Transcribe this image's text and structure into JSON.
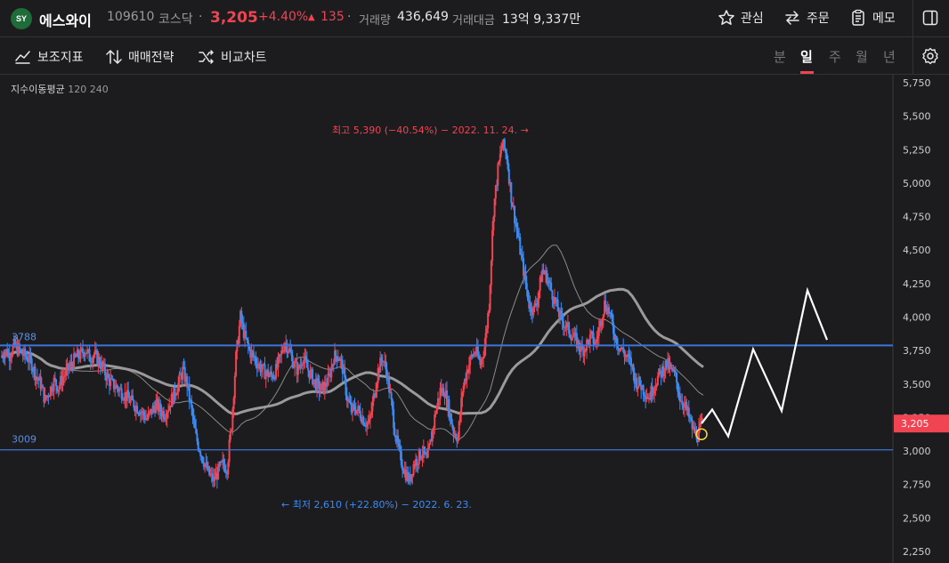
{
  "header": {
    "logo_text": "SY",
    "name": "에스와이",
    "code": "109610",
    "market": "코스닥",
    "dot": "·",
    "price": "3,205",
    "change_pct": "+4.40%",
    "change_arrow": "▲",
    "change_abs": "135",
    "volume_label": "거래량",
    "volume_value": "436,649",
    "amount_label": "거래대금",
    "amount_value": "13억 9,337만",
    "buttons": {
      "watch": "관심",
      "order": "주문",
      "memo": "메모"
    }
  },
  "toolbar": {
    "indicator": "보조지표",
    "strategy": "매매전략",
    "compare": "비교차트",
    "periods": [
      "분",
      "일",
      "주",
      "월",
      "년"
    ],
    "active_period": "일"
  },
  "legend": {
    "label": "지수이동평균",
    "p1": "120",
    "p2": "240"
  },
  "colors": {
    "up": "#f04452",
    "down": "#3d8bf2",
    "line": "#3d74d9",
    "bg": "#1c1c1f"
  },
  "chart_data": {
    "type": "candlestick",
    "ylim": [
      2250,
      5750
    ],
    "yticks": [
      "5,750",
      "5,500",
      "5,250",
      "5,000",
      "4,750",
      "4,500",
      "4,250",
      "4,000",
      "3,750",
      "3,500",
      "3,250",
      "3,000",
      "2,750",
      "2,500",
      "2,250"
    ],
    "ytick_values": [
      5750,
      5500,
      5250,
      5000,
      4750,
      4500,
      4250,
      4000,
      3750,
      3500,
      3250,
      3000,
      2750,
      2500,
      2250
    ],
    "current_price_label": "3,205",
    "current_price": 3205,
    "hlines": [
      {
        "label": "3788",
        "value": 3788
      },
      {
        "label": "3009",
        "value": 3009
      }
    ],
    "annotations": {
      "high": "최고 5,390 (−40.54%) − 2022. 11. 24. →",
      "low": "← 최저 2,610 (+22.80%) − 2022. 6. 23."
    },
    "close_path": [
      3700,
      3750,
      3720,
      3780,
      3760,
      3720,
      3700,
      3650,
      3560,
      3500,
      3380,
      3450,
      3520,
      3480,
      3550,
      3600,
      3650,
      3700,
      3720,
      3760,
      3700,
      3720,
      3680,
      3620,
      3550,
      3500,
      3480,
      3450,
      3420,
      3380,
      3350,
      3320,
      3280,
      3240,
      3300,
      3350,
      3300,
      3280,
      3350,
      3420,
      3500,
      3600,
      3500,
      3300,
      3100,
      3000,
      2900,
      2820,
      2780,
      2850,
      2900,
      2880,
      3200,
      3700,
      4000,
      3850,
      3750,
      3700,
      3650,
      3600,
      3580,
      3560,
      3600,
      3700,
      3820,
      3750,
      3650,
      3600,
      3700,
      3620,
      3560,
      3500,
      3460,
      3480,
      3550,
      3700,
      3720,
      3620,
      3400,
      3300,
      3320,
      3280,
      3220,
      3200,
      3400,
      3600,
      3700,
      3580,
      3350,
      3100,
      2950,
      2850,
      2780,
      2900,
      2950,
      3000,
      2920,
      3100,
      3300,
      3450,
      3450,
      3300,
      3150,
      3100,
      3450,
      3600,
      3700,
      3750,
      3650,
      3780,
      4100,
      4800,
      5100,
      5300,
      5200,
      4900,
      4700,
      4500,
      4300,
      4100,
      4050,
      4150,
      4350,
      4300,
      4200,
      4100,
      4000,
      3950,
      3900,
      3850,
      3800,
      3750,
      3800,
      3850,
      3800,
      3950,
      4100,
      4050,
      3900,
      3800,
      3750,
      3700,
      3650,
      3520,
      3500,
      3450,
      3400,
      3480,
      3550,
      3600,
      3650,
      3600,
      3550,
      3400,
      3350,
      3250,
      3150,
      3120,
      3205
    ],
    "projection": [
      3205,
      3310,
      3110,
      3760,
      3300,
      4200,
      3830
    ]
  }
}
